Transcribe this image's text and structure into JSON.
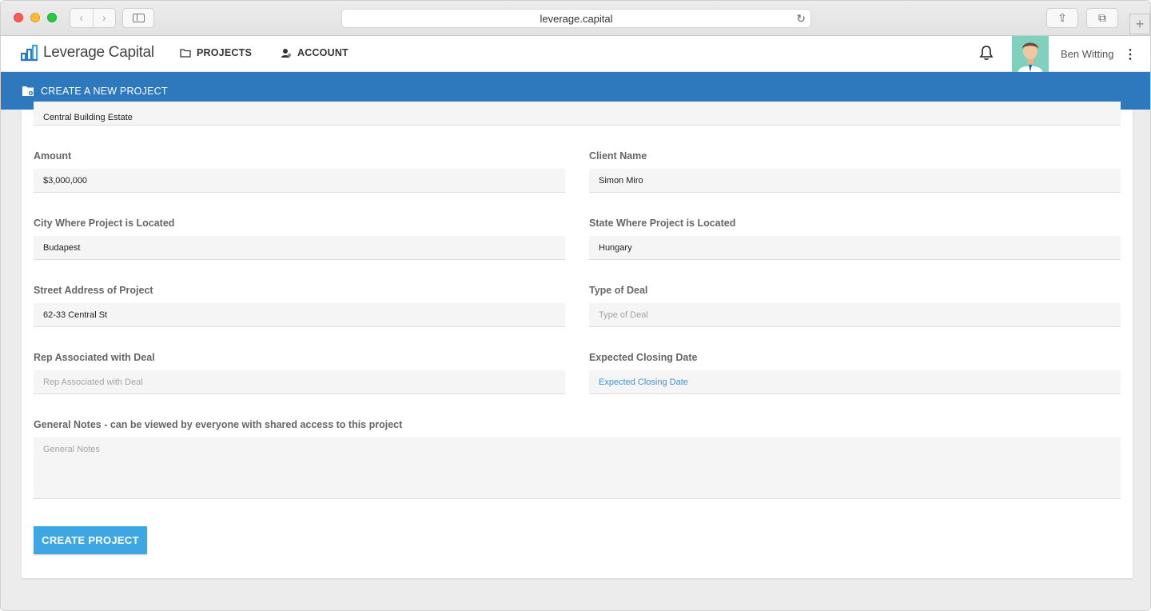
{
  "browser": {
    "url": "leverage.capital",
    "back_glyph": "‹",
    "forward_glyph": "›",
    "reload_glyph": "↻",
    "share_glyph": "⇪",
    "tabs_glyph": "⧉",
    "newtab_glyph": "+"
  },
  "header": {
    "brand": "Leverage Capital",
    "nav": {
      "projects": "PROJECTS",
      "account": "ACCOUNT"
    },
    "user_name": "Ben Witting",
    "menu_glyph": "⋮",
    "brand_color": "#2e78bd"
  },
  "banner": {
    "title": "CREATE A NEW PROJECT"
  },
  "form": {
    "project_name": {
      "value": "Central Building Estate"
    },
    "amount": {
      "label": "Amount",
      "value": "$3,000,000"
    },
    "client_name": {
      "label": "Client Name",
      "value": "Simon Miro"
    },
    "city": {
      "label": "City Where Project is Located",
      "value": "Budapest"
    },
    "state": {
      "label": "State Where Project is Located",
      "value": "Hungary"
    },
    "street": {
      "label": "Street Address of Project",
      "value": "62-33 Central St"
    },
    "deal_type": {
      "label": "Type of Deal",
      "placeholder": "Type of Deal"
    },
    "rep": {
      "label": "Rep Associated with Deal",
      "placeholder": "Rep Associated with Deal"
    },
    "closing_date": {
      "label": "Expected Closing Date",
      "placeholder": "Expected Closing Date"
    },
    "notes": {
      "label": "General Notes - can be viewed by everyone with shared access to this project",
      "placeholder": "General Notes"
    },
    "submit_label": "CREATE PROJECT"
  }
}
